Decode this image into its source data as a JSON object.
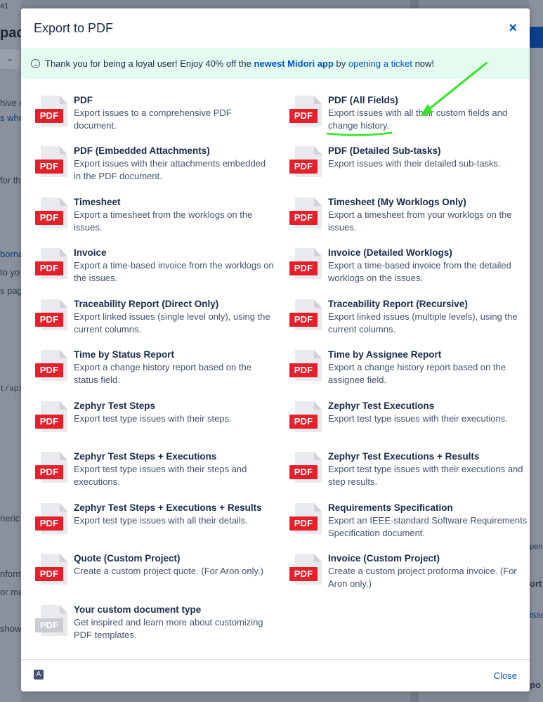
{
  "background": {
    "fragments": [
      {
        "text": "41",
        "cls": ""
      },
      {
        "text": "pac",
        "cls": "big"
      },
      {
        "text": "hive c",
        "cls": ""
      },
      {
        "text": "s whe",
        "cls": "link"
      },
      {
        "text": "for th",
        "cls": ""
      },
      {
        "text": "borna",
        "cls": "link"
      },
      {
        "text": "to yo",
        "cls": ""
      },
      {
        "text": "s pag",
        "cls": ""
      },
      {
        "text": "t/api",
        "cls": "mono"
      },
      {
        "text": "neric",
        "cls": ""
      },
      {
        "text": "nform",
        "cls": ""
      },
      {
        "text": "or ma",
        "cls": ""
      },
      {
        "text": "show",
        "cls": ""
      },
      {
        "text": "pen",
        "cls": ""
      },
      {
        "text": "ort",
        "cls": ""
      },
      {
        "text": "issu",
        "cls": "link"
      },
      {
        "text": "po",
        "cls": ""
      }
    ],
    "chevron": "⌄"
  },
  "modal": {
    "title": "Export to PDF",
    "close_icon": "×",
    "banner": {
      "text_before": "Thank you for being a loyal user! Enjoy 40% off the ",
      "highlight": "newest Midori app",
      "text_middle": " by ",
      "link": "opening a ticket",
      "text_after": " now!"
    },
    "badge_label": "PDF",
    "items": [
      {
        "title": "PDF",
        "desc": "Export issues to a comprehensive PDF document."
      },
      {
        "title": "PDF (All Fields)",
        "desc": "Export issues with all their custom fields and change history."
      },
      {
        "title": "PDF (Embedded Attachments)",
        "desc": "Export issues with their attachments embedded in the PDF document."
      },
      {
        "title": "PDF (Detailed Sub-tasks)",
        "desc": "Export issues with their detailed sub-tasks."
      },
      {
        "title": "Timesheet",
        "desc": "Export a timesheet from the worklogs on the issues."
      },
      {
        "title": "Timesheet (My Worklogs Only)",
        "desc": "Export a timesheet from your worklogs on the issues."
      },
      {
        "title": "Invoice",
        "desc": "Export a time-based invoice from the worklogs on the issues."
      },
      {
        "title": "Invoice (Detailed Worklogs)",
        "desc": "Export a time-based invoice from the detailed worklogs on the issues."
      },
      {
        "title": "Traceability Report (Direct Only)",
        "desc": "Export linked issues (single level only), using the current columns."
      },
      {
        "title": "Traceability Report (Recursive)",
        "desc": "Export linked issues (multiple levels), using the current columns."
      },
      {
        "title": "Time by Status Report",
        "desc": "Export a change history report based on the status field."
      },
      {
        "title": "Time by Assignee Report",
        "desc": "Export a change history report based on the assignee field."
      },
      {
        "title": "Zephyr Test Steps",
        "desc": "Export test type issues with their steps."
      },
      {
        "title": "Zephyr Test Executions",
        "desc": "Export test type issues with their executions."
      },
      {
        "title": "Zephyr Test Steps + Executions",
        "desc": "Export test type issues with their steps and executions."
      },
      {
        "title": "Zephyr Test Executions + Results",
        "desc": "Export test type issues with their executions and step results."
      },
      {
        "title": "Zephyr Test Steps + Executions + Results",
        "desc": "Export test type issues with all their details."
      },
      {
        "title": "Requirements Specification",
        "desc": "Export an IEEE-standard Software Requirements Specification document."
      },
      {
        "title": "Quote (Custom Project)",
        "desc": "Create a custom project quote. (For Aron only.)"
      },
      {
        "title": "Invoice (Custom Project)",
        "desc": "Create a custom project proforma invoice. (For Aron only.)"
      },
      {
        "title": "Your custom document type",
        "desc": "Get inspired and learn more about customizing PDF templates."
      }
    ],
    "footer": {
      "close_label": "Close"
    }
  },
  "colors": {
    "accent": "#0052cc",
    "badge_red": "#e5202b",
    "banner_bg": "#e3fcef",
    "annotation_green": "#2ee81f"
  }
}
